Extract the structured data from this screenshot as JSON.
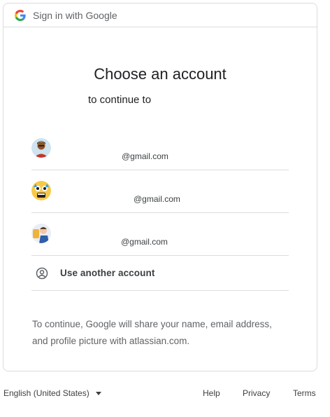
{
  "header": {
    "title": "Sign in with Google"
  },
  "main": {
    "title": "Choose an account",
    "subtitle": "to continue to"
  },
  "accounts": [
    {
      "email": " @gmail.com",
      "avatar": "avatar-person-red"
    },
    {
      "email": "@gmail.com",
      "avatar": "avatar-emoji-yellow"
    },
    {
      "email": "@gmail.com",
      "avatar": "avatar-cartoon-blue"
    }
  ],
  "use_another": {
    "label": "Use another account",
    "icon": "account-circle-icon"
  },
  "disclaimer": "To continue, Google will share your name, email address, and profile picture with atlassian.com.",
  "footer": {
    "language": "English (United States)",
    "help": "Help",
    "privacy": "Privacy",
    "terms": "Terms"
  },
  "colors": {
    "google_blue": "#4285F4",
    "google_red": "#EA4335",
    "google_yellow": "#FBBC05",
    "google_green": "#34A853",
    "border": "#dadce0",
    "text_secondary": "#5f6368"
  }
}
